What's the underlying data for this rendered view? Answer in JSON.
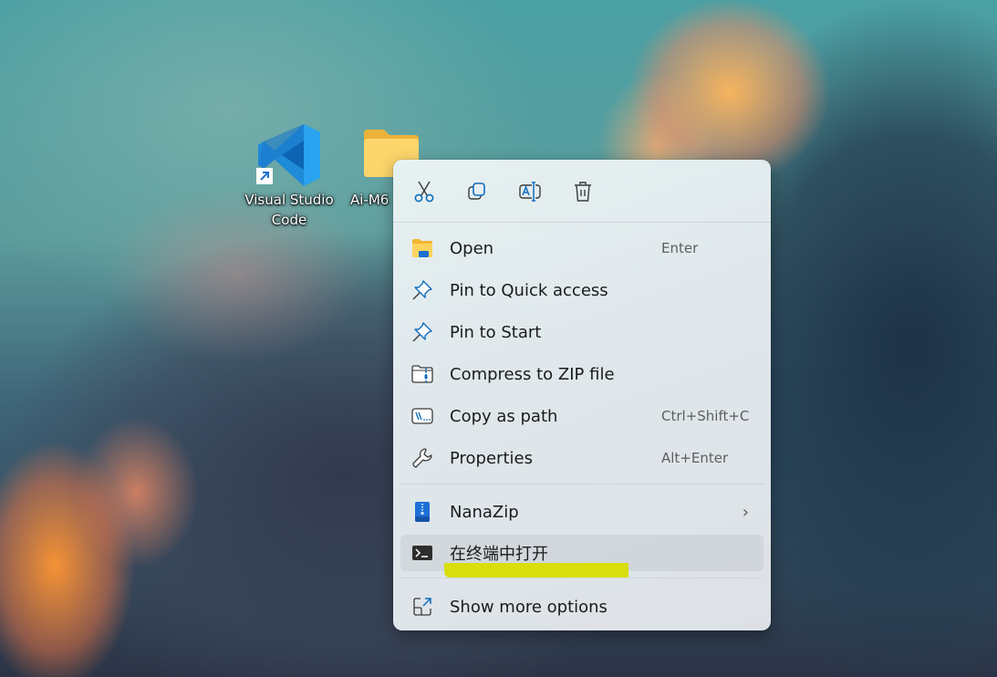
{
  "desktop": {
    "icons": [
      {
        "label_line1": "Visual Studio",
        "label_line2": "Code",
        "icon": "vscode-icon",
        "shortcut": true
      },
      {
        "label": "Ai-M6",
        "icon": "folder-icon"
      }
    ]
  },
  "context_menu": {
    "toolbar": [
      {
        "name": "cut",
        "icon": "scissors-icon"
      },
      {
        "name": "copy",
        "icon": "copy-icon"
      },
      {
        "name": "rename",
        "icon": "rename-icon"
      },
      {
        "name": "delete",
        "icon": "trash-icon"
      }
    ],
    "items": [
      {
        "label": "Open",
        "shortcut": "Enter",
        "icon": "folder-open-icon"
      },
      {
        "label": "Pin to Quick access",
        "shortcut": "",
        "icon": "pin-icon"
      },
      {
        "label": "Pin to Start",
        "shortcut": "",
        "icon": "pin-icon"
      },
      {
        "label": "Compress to ZIP file",
        "shortcut": "",
        "icon": "zip-folder-icon"
      },
      {
        "label": "Copy as path",
        "shortcut": "Ctrl+Shift+C",
        "icon": "path-icon"
      },
      {
        "label": "Properties",
        "shortcut": "Alt+Enter",
        "icon": "wrench-icon"
      }
    ],
    "group2": [
      {
        "label": "NanaZip",
        "icon": "nanazip-icon",
        "submenu": true
      },
      {
        "label": "在终端中打开",
        "icon": "terminal-icon",
        "hovered": true
      }
    ],
    "footer": {
      "label": "Show more options",
      "icon": "expand-icon"
    }
  },
  "colors": {
    "accent": "#0f6cbd",
    "highlight_marker": "#d9de00"
  }
}
